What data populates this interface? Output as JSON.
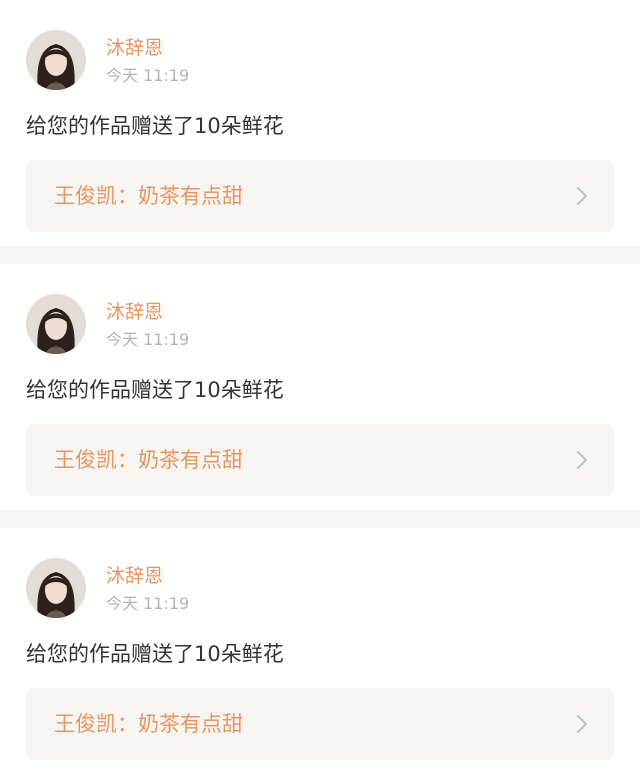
{
  "notifications": [
    {
      "username": "沐辞恩",
      "timestamp": "今天 11:19",
      "message": "给您的作品赠送了10朵鲜花",
      "work_title": "王俊凯：奶茶有点甜"
    },
    {
      "username": "沐辞恩",
      "timestamp": "今天 11:19",
      "message": "给您的作品赠送了10朵鲜花",
      "work_title": "王俊凯：奶茶有点甜"
    },
    {
      "username": "沐辞恩",
      "timestamp": "今天 11:19",
      "message": "给您的作品赠送了10朵鲜花",
      "work_title": "王俊凯：奶茶有点甜"
    }
  ],
  "icons": {
    "avatar": "user-avatar-photo",
    "chevron": "chevron-right-icon"
  },
  "colors": {
    "accent": "#e8955f",
    "timestamp": "#b4b4b4",
    "text": "#333333",
    "link_background": "#f6f5f1",
    "feed_background": "#f5f5f5"
  }
}
